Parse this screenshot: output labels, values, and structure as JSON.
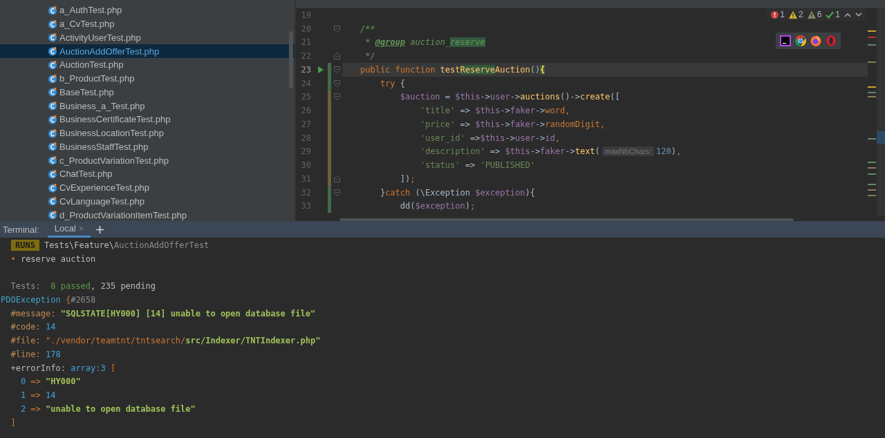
{
  "project_tree": {
    "items": [
      {
        "label": "a_AuthTest.php",
        "selected": false
      },
      {
        "label": "a_CvTest.php",
        "selected": false
      },
      {
        "label": "ActivityUserTest.php",
        "selected": false
      },
      {
        "label": "AuctionAddOfferTest.php",
        "selected": true
      },
      {
        "label": "AuctionTest.php",
        "selected": false
      },
      {
        "label": "b_ProductTest.php",
        "selected": false
      },
      {
        "label": "BaseTest.php",
        "selected": false
      },
      {
        "label": "Business_a_Test.php",
        "selected": false
      },
      {
        "label": "BusinessCertificateTest.php",
        "selected": false
      },
      {
        "label": "BusinessLocationTest.php",
        "selected": false
      },
      {
        "label": "BusinessStaffTest.php",
        "selected": false
      },
      {
        "label": "c_ProductVariationTest.php",
        "selected": false
      },
      {
        "label": "ChatTest.php",
        "selected": false
      },
      {
        "label": "CvExperienceTest.php",
        "selected": false
      },
      {
        "label": "CvLanguageTest.php",
        "selected": false
      },
      {
        "label": "d_ProductVariationItemTest.php",
        "selected": false
      }
    ]
  },
  "editor": {
    "lines": [
      {
        "number": "19",
        "current": false,
        "run": false,
        "fold_start": false,
        "fold_end": false,
        "added": false,
        "modified": false
      },
      {
        "number": "20",
        "current": false,
        "run": false,
        "fold_start": true,
        "fold_end": false,
        "added": false,
        "modified": false,
        "tokens": [
          {
            "kind": "comment",
            "text": "/**"
          }
        ]
      },
      {
        "number": "21",
        "current": false,
        "run": false,
        "fold_start": false,
        "fold_end": false,
        "added": false,
        "modified": false,
        "tokens": [
          {
            "kind": "comment",
            "text": " * "
          },
          {
            "kind": "doc-tag",
            "text": "@group"
          },
          {
            "kind": "comment",
            "text": " auction_"
          },
          {
            "kind": "comment-match",
            "text": "reserve"
          }
        ]
      },
      {
        "number": "22",
        "current": false,
        "run": false,
        "fold_start": false,
        "fold_end": true,
        "added": false,
        "modified": false,
        "tokens": [
          {
            "kind": "comment",
            "text": " */"
          }
        ]
      },
      {
        "number": "23",
        "current": true,
        "run": true,
        "fold_start": true,
        "fold_end": false,
        "added": true,
        "modified": false,
        "tokens": [
          {
            "kind": "keyword",
            "text": "public function "
          },
          {
            "kind": "method",
            "text": "test"
          },
          {
            "kind": "method-match",
            "text": "Reserve"
          },
          {
            "kind": "method",
            "text": "Auction"
          },
          {
            "kind": "plain",
            "text": "()"
          },
          {
            "kind": "brace-match",
            "text": "{"
          }
        ]
      },
      {
        "number": "24",
        "current": false,
        "run": false,
        "fold_start": true,
        "fold_end": false,
        "added": true,
        "modified": false,
        "tokens": [
          {
            "kind": "keyword",
            "text": "    try"
          },
          {
            "kind": "plain",
            "text": " {"
          }
        ]
      },
      {
        "number": "25",
        "current": false,
        "run": false,
        "fold_start": true,
        "fold_end": false,
        "added": false,
        "modified": true,
        "tokens": [
          {
            "kind": "var",
            "text": "        $auction"
          },
          {
            "kind": "plain",
            "text": " = "
          },
          {
            "kind": "var",
            "text": "$this"
          },
          {
            "kind": "plain",
            "text": "->"
          },
          {
            "kind": "field",
            "text": "user"
          },
          {
            "kind": "plain",
            "text": "->"
          },
          {
            "kind": "method",
            "text": "auctions"
          },
          {
            "kind": "plain",
            "text": "()->"
          },
          {
            "kind": "method",
            "text": "create"
          },
          {
            "kind": "plain",
            "text": "(["
          }
        ]
      },
      {
        "number": "26",
        "current": false,
        "run": false,
        "fold_start": false,
        "fold_end": false,
        "added": false,
        "modified": true,
        "tokens": [
          {
            "kind": "string",
            "text": "            'title'"
          },
          {
            "kind": "plain",
            "text": " => "
          },
          {
            "kind": "var",
            "text": "$this"
          },
          {
            "kind": "plain",
            "text": "->"
          },
          {
            "kind": "field",
            "text": "faker"
          },
          {
            "kind": "plain",
            "text": "->"
          },
          {
            "kind": "magic",
            "text": "word"
          },
          {
            "kind": "keyword",
            "text": ","
          }
        ]
      },
      {
        "number": "27",
        "current": false,
        "run": false,
        "fold_start": false,
        "fold_end": false,
        "added": false,
        "modified": true,
        "tokens": [
          {
            "kind": "string",
            "text": "            'price'"
          },
          {
            "kind": "plain",
            "text": " => "
          },
          {
            "kind": "var",
            "text": "$this"
          },
          {
            "kind": "plain",
            "text": "->"
          },
          {
            "kind": "field",
            "text": "faker"
          },
          {
            "kind": "plain",
            "text": "->"
          },
          {
            "kind": "magic",
            "text": "randomDigit"
          },
          {
            "kind": "keyword",
            "text": ","
          }
        ]
      },
      {
        "number": "28",
        "current": false,
        "run": false,
        "fold_start": false,
        "fold_end": false,
        "added": false,
        "modified": true,
        "tokens": [
          {
            "kind": "string",
            "text": "            'user_id'"
          },
          {
            "kind": "plain",
            "text": " =>"
          },
          {
            "kind": "var",
            "text": "$this"
          },
          {
            "kind": "plain",
            "text": "->"
          },
          {
            "kind": "field",
            "text": "user"
          },
          {
            "kind": "plain",
            "text": "->"
          },
          {
            "kind": "field",
            "text": "id"
          },
          {
            "kind": "keyword",
            "text": ","
          }
        ]
      },
      {
        "number": "29",
        "current": false,
        "run": false,
        "fold_start": false,
        "fold_end": false,
        "added": false,
        "modified": true,
        "tokens": [
          {
            "kind": "string",
            "text": "            'description'"
          },
          {
            "kind": "plain",
            "text": " => "
          },
          {
            "kind": "var",
            "text": "$this"
          },
          {
            "kind": "plain",
            "text": "->"
          },
          {
            "kind": "field",
            "text": "faker"
          },
          {
            "kind": "plain",
            "text": "->"
          },
          {
            "kind": "method",
            "text": "text"
          },
          {
            "kind": "plain",
            "text": "("
          },
          {
            "kind": "hint",
            "text": "maxNbChars:"
          },
          {
            "kind": "number",
            "text": "120"
          },
          {
            "kind": "plain",
            "text": ")"
          },
          {
            "kind": "keyword",
            "text": ","
          }
        ]
      },
      {
        "number": "30",
        "current": false,
        "run": false,
        "fold_start": false,
        "fold_end": false,
        "added": false,
        "modified": true,
        "tokens": [
          {
            "kind": "string",
            "text": "            'status'"
          },
          {
            "kind": "plain",
            "text": " => "
          },
          {
            "kind": "string",
            "text": "'PUBLISHED'"
          }
        ]
      },
      {
        "number": "31",
        "current": false,
        "run": false,
        "fold_start": false,
        "fold_end": true,
        "added": false,
        "modified": true,
        "tokens": [
          {
            "kind": "plain",
            "text": "        ])"
          },
          {
            "kind": "keyword",
            "text": ";"
          }
        ]
      },
      {
        "number": "32",
        "current": false,
        "run": false,
        "fold_start": true,
        "fold_end": false,
        "added": true,
        "modified": false,
        "tokens": [
          {
            "kind": "plain",
            "text": "    }"
          },
          {
            "kind": "keyword",
            "text": "catch"
          },
          {
            "kind": "plain",
            "text": " (\\Exception "
          },
          {
            "kind": "var",
            "text": "$exception"
          },
          {
            "kind": "plain",
            "text": "){"
          }
        ]
      },
      {
        "number": "33",
        "current": false,
        "run": false,
        "fold_start": false,
        "fold_end": false,
        "added": true,
        "modified": false,
        "tokens": [
          {
            "kind": "plain",
            "text": "        dd("
          },
          {
            "kind": "var",
            "text": "$exception"
          },
          {
            "kind": "plain",
            "text": ")"
          },
          {
            "kind": "keyword",
            "text": ";"
          }
        ]
      }
    ]
  },
  "inspections": [
    {
      "kind": "error",
      "count": "1"
    },
    {
      "kind": "warning",
      "count": "2"
    },
    {
      "kind": "weak-warning",
      "count": "6"
    },
    {
      "kind": "typo",
      "count": "1"
    }
  ],
  "browsers": [
    {
      "kind": "phpstorm"
    },
    {
      "kind": "chrome"
    },
    {
      "kind": "firefox"
    },
    {
      "kind": "opera"
    }
  ],
  "terminal": {
    "title": "Terminal:",
    "tabs": [
      {
        "label": "Local",
        "selected": true
      }
    ],
    "lines": [
      {
        "kind": "text",
        "tokens": [
          {
            "kind": "badge",
            "text": "RUNS"
          },
          {
            "kind": "plain",
            "text": "Tests\\Feature\\"
          },
          {
            "kind": "dim",
            "text": "AuctionAddOfferTest"
          }
        ]
      },
      {
        "kind": "text",
        "tokens": [
          {
            "kind": "bullet",
            "text": "  •"
          },
          {
            "kind": "plain",
            "text": " reserve auction"
          }
        ]
      },
      {
        "kind": "blank"
      },
      {
        "kind": "text",
        "tokens": [
          {
            "kind": "dim",
            "text": "  Tests:  "
          },
          {
            "kind": "green",
            "text": "8 passed"
          },
          {
            "kind": "plain",
            "text": ", 235 pending"
          }
        ]
      },
      {
        "kind": "text",
        "tokens": [
          {
            "kind": "class",
            "text": "PDOException"
          },
          {
            "kind": "bracket",
            "text": " {"
          },
          {
            "kind": "dim",
            "text": "#2658"
          }
        ]
      },
      {
        "kind": "text",
        "tokens": [
          {
            "kind": "key",
            "text": "  #message: "
          },
          {
            "kind": "string",
            "text": "\"SQLSTATE[HY000] [14] unable to open database file\""
          }
        ]
      },
      {
        "kind": "text",
        "tokens": [
          {
            "kind": "key",
            "text": "  #code: "
          },
          {
            "kind": "number",
            "text": "14"
          }
        ]
      },
      {
        "kind": "text",
        "tokens": [
          {
            "kind": "key",
            "text": "  #file: "
          },
          {
            "kind": "path",
            "text": "\"./vendor/teamtnt/tntsearch/"
          },
          {
            "kind": "string",
            "text": "src/Indexer/TNTIndexer.php\""
          }
        ]
      },
      {
        "kind": "text",
        "tokens": [
          {
            "kind": "key",
            "text": "  #line: "
          },
          {
            "kind": "number",
            "text": "178"
          }
        ]
      },
      {
        "kind": "text",
        "tokens": [
          {
            "kind": "plain",
            "text": "  +errorInfo: "
          },
          {
            "kind": "number",
            "text": "array:3"
          },
          {
            "kind": "bracket",
            "text": " ["
          }
        ]
      },
      {
        "kind": "text",
        "tokens": [
          {
            "kind": "number",
            "text": "    0"
          },
          {
            "kind": "bracket",
            "text": " => "
          },
          {
            "kind": "string",
            "text": "\"HY000\""
          }
        ]
      },
      {
        "kind": "text",
        "tokens": [
          {
            "kind": "number",
            "text": "    1"
          },
          {
            "kind": "bracket",
            "text": " => "
          },
          {
            "kind": "number",
            "text": "14"
          }
        ]
      },
      {
        "kind": "text",
        "tokens": [
          {
            "kind": "number",
            "text": "    2"
          },
          {
            "kind": "bracket",
            "text": " => "
          },
          {
            "kind": "string",
            "text": "\"unable to open database file\""
          }
        ]
      },
      {
        "kind": "text",
        "tokens": [
          {
            "kind": "bracket",
            "text": "  ]"
          }
        ]
      }
    ]
  }
}
